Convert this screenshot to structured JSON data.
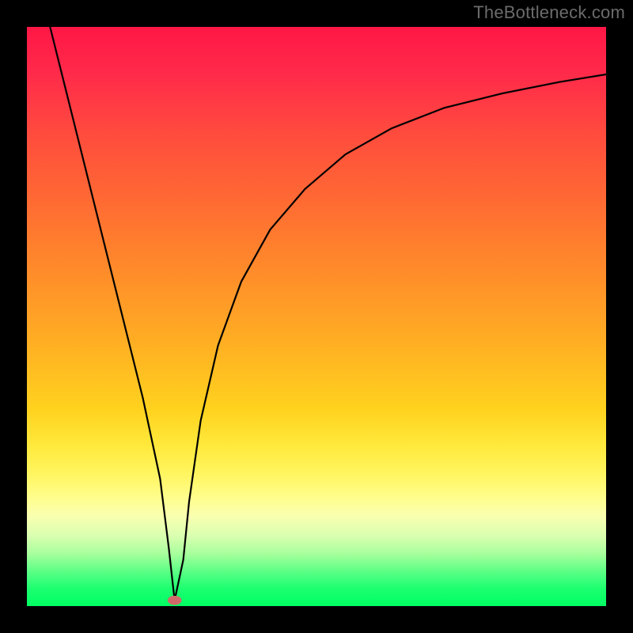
{
  "watermark": "TheBottleneck.com",
  "colors": {
    "frame": "#000000",
    "curve": "#000000",
    "dot": "#d06a6a"
  },
  "chart_data": {
    "type": "line",
    "title": "",
    "xlabel": "",
    "ylabel": "",
    "xlim": [
      0,
      100
    ],
    "ylim": [
      0,
      100
    ],
    "grid": false,
    "legend": false,
    "background_gradient": [
      {
        "pos": 0,
        "color": "#ff1746"
      },
      {
        "pos": 50,
        "color": "#ffad23"
      },
      {
        "pos": 80,
        "color": "#fffd8a"
      },
      {
        "pos": 100,
        "color": "#00ff62"
      }
    ],
    "series": [
      {
        "name": "bottleneck-curve",
        "x": [
          4,
          8,
          12,
          16,
          20,
          23,
          24.5,
          25.5,
          27,
          28,
          30,
          33,
          37,
          42,
          48,
          55,
          63,
          72,
          82,
          92,
          100
        ],
        "y": [
          100,
          84,
          68,
          52,
          36,
          22,
          10,
          1,
          8,
          18,
          32,
          45,
          56,
          65,
          72,
          78,
          82.5,
          86,
          88.5,
          90.5,
          91.8
        ]
      }
    ],
    "annotations": [
      {
        "type": "point",
        "name": "optimal",
        "x": 25.5,
        "y": 1,
        "shape": "ellipse",
        "rx": 1.2,
        "ry": 0.8,
        "fill": "#d06a6a"
      }
    ]
  }
}
